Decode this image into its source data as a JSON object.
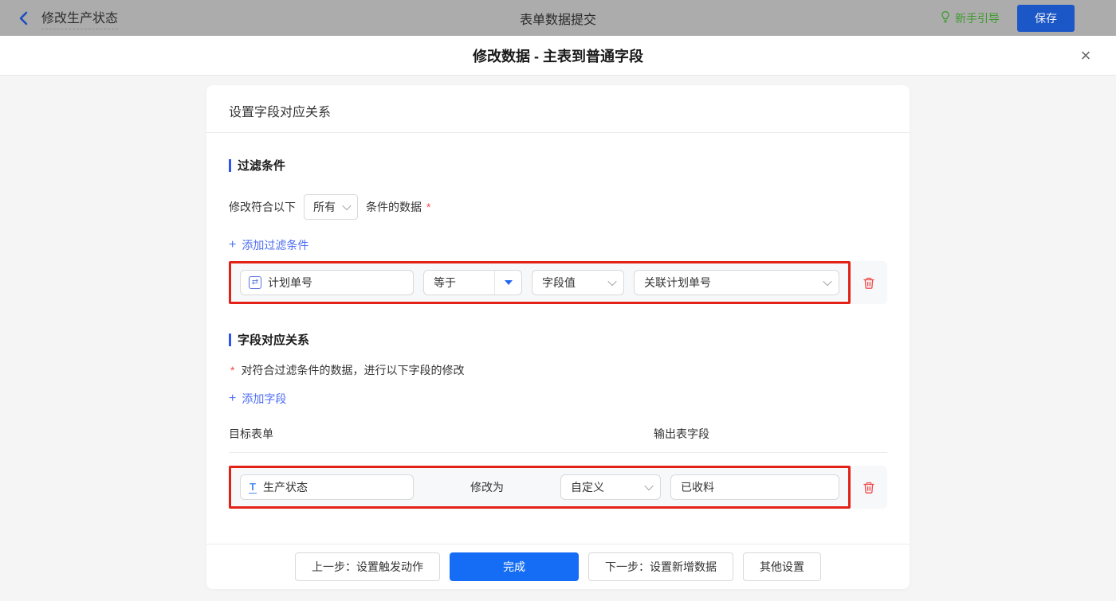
{
  "topbar": {
    "back_label": "修改生产状态",
    "title": "表单数据提交",
    "guide_label": "新手引导",
    "save_label": "保存"
  },
  "modal": {
    "title": "修改数据 - 主表到普通字段",
    "close_icon": "×"
  },
  "panel": {
    "header": "设置字段对应关系"
  },
  "filter": {
    "section_title": "过滤条件",
    "match_prefix": "修改符合以下",
    "match_value": "所有",
    "match_suffix": "条件的数据",
    "required_mark": "*",
    "add_icon": "+",
    "add_label": "添加过滤条件",
    "row": {
      "field_icon": "⇄",
      "field": "计划单号",
      "operator": "等于",
      "value_type": "字段值",
      "value": "关联计划单号"
    }
  },
  "mapping": {
    "section_title": "字段对应关系",
    "required_mark": "*",
    "hint": "对符合过滤条件的数据，进行以下字段的修改",
    "add_icon": "+",
    "add_label": "添加字段",
    "columns": {
      "left": "目标表单",
      "right": "输出表字段"
    },
    "row": {
      "field_icon": "T",
      "field": "生产状态",
      "action_label": "修改为",
      "value_type": "自定义",
      "value": "已收料"
    }
  },
  "footer": {
    "prev": "上一步：设置触发动作",
    "done": "完成",
    "next": "下一步：设置新增数据",
    "other": "其他设置"
  },
  "colors": {
    "primary_blue": "#156df5",
    "link_blue": "#4e6ef2",
    "accent_bar_blue": "#2f54eb",
    "highlight_red": "#e32117",
    "danger_red": "#f04b4b",
    "guide_green": "#3f9b2e",
    "dimmed_save_blue": "#1c57c8",
    "topbar_dimmed_gray": "#acacac"
  }
}
